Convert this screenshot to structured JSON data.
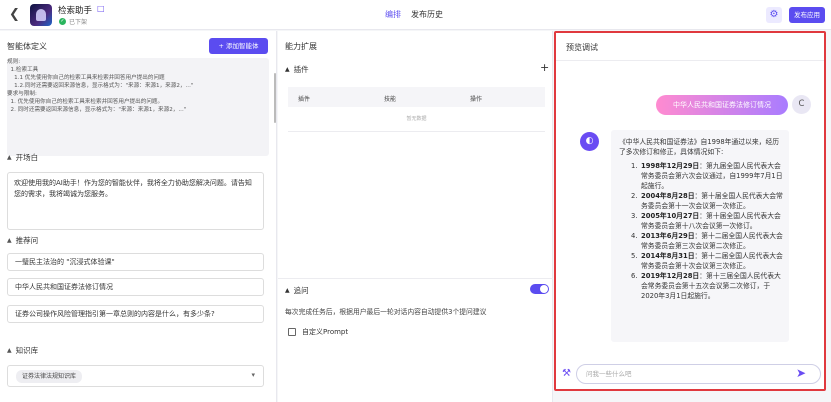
{
  "header": {
    "back_icon": "chevron-left-icon",
    "app_title": "检索助手",
    "status": "已下架",
    "tabs": [
      "编排",
      "发布历史"
    ],
    "active_tab": "编排",
    "publish_label": "发布应用",
    "accent": "#5b4cf0"
  },
  "left": {
    "title": "智能体定义",
    "add_agent_label": "+ 添加智能体",
    "prompt_lines": [
      "规则:",
      "  1.检索工具",
      "    1.1 优先使用你自己的检索工具来检索并回答用户提出的问题",
      "    1.2.同时还需要返回来源信息，显示格式为：\"来源：来源1，来源2，...\"",
      "要求与限制:",
      "  1. 优先使用你自己的检索工具来检索并回答用户提出的问题。",
      "  2. 同时还需要返回来源信息，显示格式为：\"来源：来源1，来源2，...\""
    ],
    "opening_title": "开场白",
    "opening_text": "欢迎使用我的AI助手！作为您的智能伙伴，我将全力协助您解决问题。请告知您的需求，我将竭诚为您服务。",
    "suggest_title": "推荐问",
    "suggestions": [
      "一璧民主法治的 \"沉浸式体验课\"",
      "中华人民共和国证券法修订情况",
      "证券公司操作风险管理指引第一章总则的内容是什么，有多少条?"
    ],
    "kb_title": "知识库",
    "kb_tag": "证券法律法规知识库"
  },
  "middle": {
    "title": "能力扩展",
    "plugin_title": "插件",
    "columns": [
      "插件",
      "技能",
      "操作"
    ],
    "empty_text": "暂无数据",
    "followup_title": "追问",
    "followup_desc": "每次完成任务后，根据用户最后一轮对话内容自动提供3个提问建议",
    "custom_prompt_label": "自定义Prompt"
  },
  "preview": {
    "title": "预览调试",
    "user_message": "中华人民共和国证券法修订情况",
    "user_initial": "C",
    "bot_intro": "《中华人民共和国证券法》自1998年通过以来，经历了多次修订和修正，具体情况如下:",
    "bot_items": [
      {
        "num": "1.",
        "date": "1998年12月29日",
        "text": "：第九届全国人民代表大会常务委员会第六次会议通过，自1999年7月1日起施行。"
      },
      {
        "num": "2.",
        "date": "2004年8月28日",
        "text": "：第十届全国人民代表大会常务委员会第十一次会议第一次修正。"
      },
      {
        "num": "3.",
        "date": "2005年10月27日",
        "text": "：第十届全国人民代表大会常务委员会第十八次会议第一次修订。"
      },
      {
        "num": "4.",
        "date": "2013年6月29日",
        "text": "：第十二届全国人民代表大会常务委员会第三次会议第二次修正。"
      },
      {
        "num": "5.",
        "date": "2014年8月31日",
        "text": "：第十二届全国人民代表大会常务委员会第十次会议第三次修正。"
      },
      {
        "num": "6.",
        "date": "2019年12月28日",
        "text": "：第十三届全国人民代表大会常务委员会第十五次会议第二次修订，于2020年3月1日起施行。"
      }
    ],
    "input_placeholder": "问我一些什么吧",
    "highlight_color": "#e0393e"
  }
}
